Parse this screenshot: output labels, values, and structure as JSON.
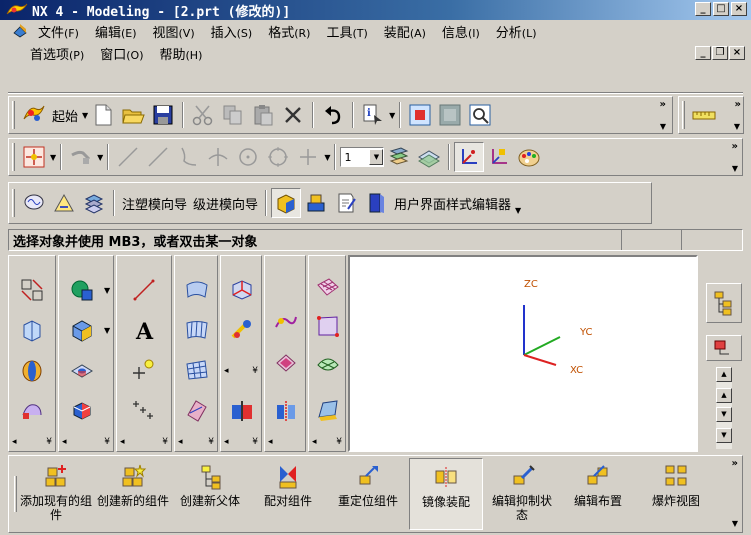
{
  "window": {
    "title": "NX 4 - Modeling - [2.prt (修改的)]",
    "minimize": "_",
    "maximize": "□",
    "close": "×"
  },
  "menu": {
    "row1": [
      {
        "label": "文件",
        "key": "(F)"
      },
      {
        "label": "编辑",
        "key": "(E)"
      },
      {
        "label": "视图",
        "key": "(V)"
      },
      {
        "label": "插入",
        "key": "(S)"
      },
      {
        "label": "格式",
        "key": "(R)"
      },
      {
        "label": "工具",
        "key": "(T)"
      },
      {
        "label": "装配",
        "key": "(A)"
      },
      {
        "label": "信息",
        "key": "(I)"
      },
      {
        "label": "分析",
        "key": "(L)"
      }
    ],
    "row2": [
      {
        "label": "首选项",
        "key": "(P)"
      },
      {
        "label": "窗口",
        "key": "(O)"
      },
      {
        "label": "帮助",
        "key": "(H)"
      }
    ],
    "mdi_minimize": "_",
    "mdi_restore": "❐",
    "mdi_close": "×"
  },
  "toolbar1": {
    "start_label": "起始"
  },
  "toolbar2": {
    "layer_value": "1"
  },
  "toolbar3": {
    "mold_wizard": "注塑模向导",
    "progressive_wizard": "级进模向导",
    "ui_styler": "用户界面样式编辑器"
  },
  "status": {
    "prompt": "选择对象并使用 MB3，或者双击某一对象"
  },
  "viewport": {
    "zc": "ZC",
    "yc": "YC",
    "xc": "XC"
  },
  "assembly_toolbar": {
    "items": [
      {
        "label": "添加现有的组件"
      },
      {
        "label": "创建新的组件"
      },
      {
        "label": "创建新父体"
      },
      {
        "label": "配对组件"
      },
      {
        "label": "重定位组件"
      },
      {
        "label": "镜像装配"
      },
      {
        "label": "编辑抑制状态"
      },
      {
        "label": "编辑布置"
      },
      {
        "label": "爆炸视图"
      }
    ]
  },
  "colors": {
    "title_bar": "#0a246a",
    "face": "#d4d0c8",
    "axis_z": "#2233cc",
    "axis_y": "#22aa22",
    "axis_x": "#dd2222",
    "axis_label": "#c05000"
  }
}
